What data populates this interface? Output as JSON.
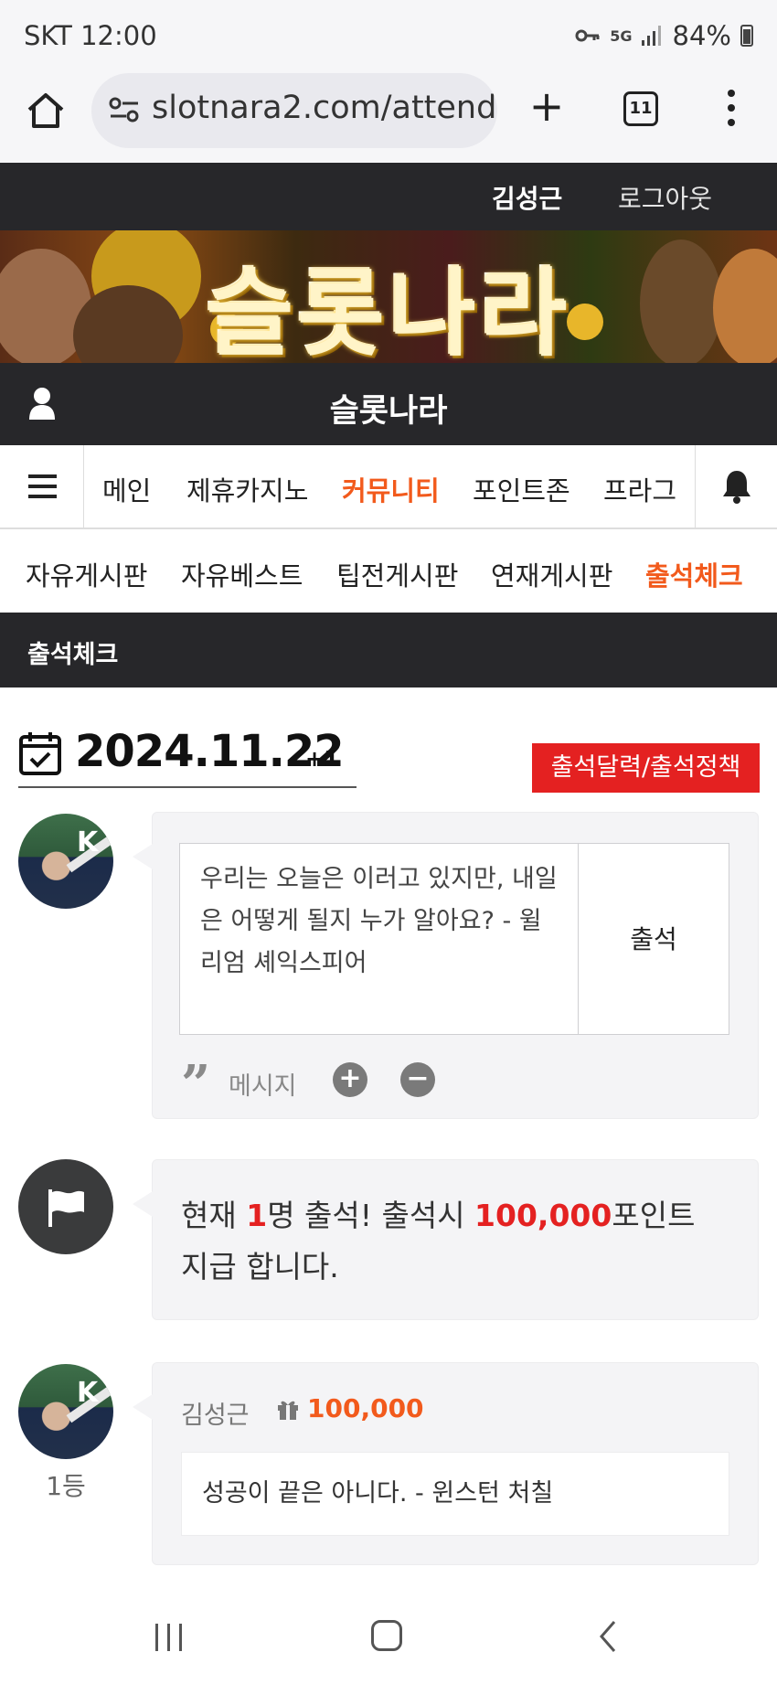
{
  "status_bar": {
    "carrier_time": "SKT 12:00",
    "network": "5G",
    "battery": "84%"
  },
  "browser": {
    "url": "slotnara2.com/attend",
    "tab_count": "11",
    "new_tab": "+"
  },
  "site": {
    "user_name": "김성근",
    "logout_label": "로그아웃",
    "banner_title": "슬롯나라",
    "site_name": "슬롯나라"
  },
  "main_nav": {
    "items": [
      "메인",
      "제휴카지노",
      "커뮤니티",
      "포인트존",
      "프라그"
    ],
    "active": "커뮤니티"
  },
  "sub_nav": {
    "items": [
      "자유게시판",
      "자유베스트",
      "팁전게시판",
      "연재게시판",
      "출석체크"
    ],
    "active": "출석체크"
  },
  "section": {
    "title": "출석체크"
  },
  "attendance": {
    "date": "2024.11.22",
    "date_suffix": "+1",
    "policy_button": "출석달력/출석정책",
    "message_text": "우리는 오늘은 이러고 있지만, 내일은 어떻게 될지 누가 알아요? - 윌리엄 셰익스피어",
    "attend_button": "출석",
    "message_label": "메시지",
    "plus_label": "+",
    "minus_label": "−"
  },
  "notice": {
    "part1": "현재 ",
    "count": "1",
    "part2": "명 출석! 출석시 ",
    "points": "100,000",
    "part3": "포인트 지급 합니다."
  },
  "entries": [
    {
      "rank": "1등",
      "author": "김성근",
      "points": "100,000",
      "message": "성공이 끝은 아니다. - 윈스턴 처칠"
    }
  ],
  "colors": {
    "accent_orange": "#f25a1c",
    "accent_red": "#e42121",
    "dark_bar": "#27272a"
  }
}
